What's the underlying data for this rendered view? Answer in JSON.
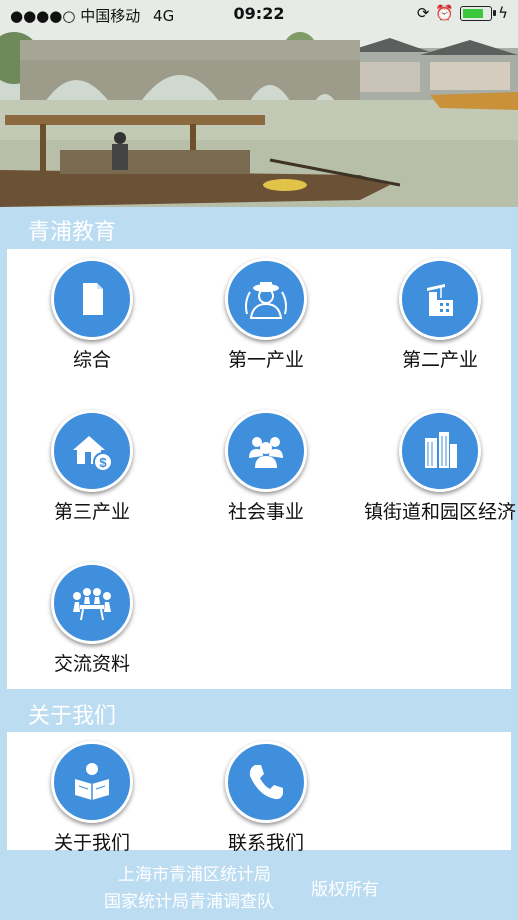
{
  "status": {
    "signal_dots": "●●●●○",
    "carrier": "中国移动",
    "network": "4G",
    "time": "09:22",
    "battery_level": 0.75
  },
  "hero": {
    "image": "canal-town-bridge-boats-photo"
  },
  "sections": {
    "education": {
      "title": "青浦教育",
      "items": [
        {
          "label": "综合",
          "icon": "document-icon"
        },
        {
          "label": "第一产业",
          "icon": "farmer-icon"
        },
        {
          "label": "第二产业",
          "icon": "factory-icon"
        },
        {
          "label": "第三产业",
          "icon": "house-money-icon"
        },
        {
          "label": "社会事业",
          "icon": "people-group-icon"
        },
        {
          "label": "镇街道和园区经济",
          "icon": "buildings-icon"
        },
        {
          "label": "交流资料",
          "icon": "meeting-icon"
        }
      ]
    },
    "about": {
      "title": "关于我们",
      "items": [
        {
          "label": "关于我们",
          "icon": "reader-icon"
        },
        {
          "label": "联系我们",
          "icon": "phone-icon"
        }
      ]
    }
  },
  "footer": {
    "line1": "上海市青浦区统计局",
    "line2": "国家统计局青浦调查队",
    "rights": "版权所有"
  },
  "colors": {
    "background": "#bcdcf2",
    "icon_circle": "#3f8fdc"
  }
}
